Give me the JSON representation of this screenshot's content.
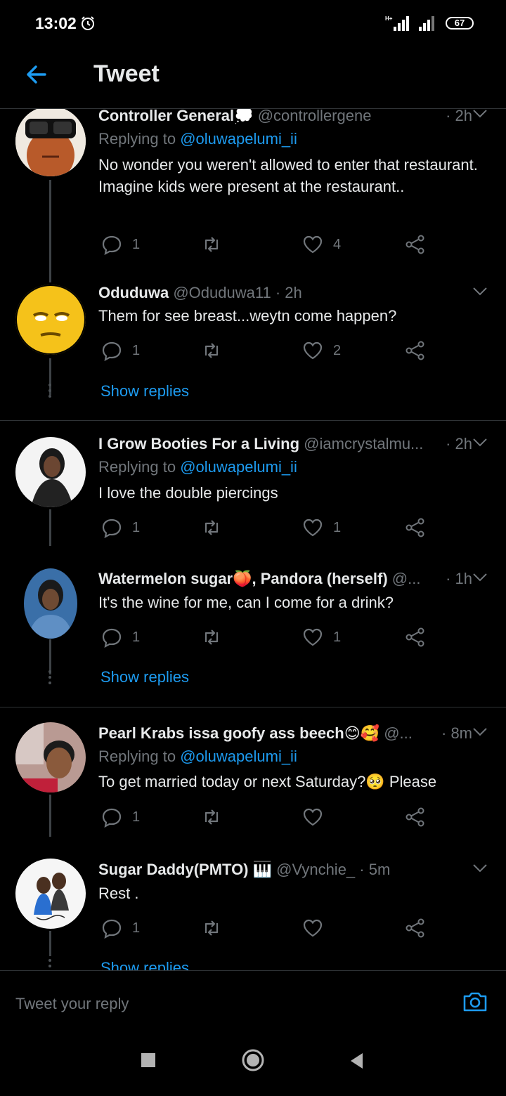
{
  "status_bar": {
    "time": "13:02",
    "network": "H+",
    "battery": "67"
  },
  "header": {
    "title": "Tweet",
    "back_icon": "back-arrow-icon"
  },
  "tweets": [
    {
      "name": "Controller General💭",
      "handle": "@controllergene",
      "time": "· 2h",
      "replying_prefix": "Replying to",
      "replying_to": "@oluwapelumi_ii",
      "text": "No wonder you weren't allowed to enter that restaurant. Imagine kids were present at the restaurant..",
      "replies": "1",
      "retweets": "",
      "likes": "4"
    },
    {
      "name": "Oduduwa",
      "handle": "@Oduduwa11",
      "time": "· 2h",
      "text": "Them for see breast...weytn come happen?",
      "replies": "1",
      "retweets": "",
      "likes": "2",
      "show_replies": "Show replies"
    },
    {
      "name": "I Grow Booties For a Living",
      "handle": "@iamcrystalmu...",
      "time": "· 2h",
      "replying_prefix": "Replying to",
      "replying_to": "@oluwapelumi_ii",
      "text": "I love the double piercings",
      "replies": "1",
      "retweets": "",
      "likes": "1"
    },
    {
      "name": "Watermelon sugar🍑, Pandora (herself)",
      "handle": "@...",
      "time": "· 1h",
      "text": "It's the wine for me, can I come for a drink?",
      "replies": "1",
      "retweets": "",
      "likes": "1",
      "show_replies": "Show replies"
    },
    {
      "name": "Pearl Krabs issa goofy ass beech😊🥰",
      "handle": "@...",
      "time": "· 8m",
      "replying_prefix": "Replying to",
      "replying_to": "@oluwapelumi_ii",
      "text": "To get married today or next Saturday?🥺 Please",
      "replies": "1",
      "retweets": "",
      "likes": ""
    },
    {
      "name": "Sugar Daddy(PMTO) 🎹",
      "handle": "@Vynchie_",
      "time": "· 5m",
      "text": "Rest .",
      "replies": "1",
      "retweets": "",
      "likes": "",
      "show_replies": "Show replies"
    }
  ],
  "reply_bar": {
    "placeholder": "Tweet your reply",
    "icon": "camera-icon"
  },
  "nav_bar": {
    "icons": [
      "recents-icon",
      "home-icon",
      "back-icon"
    ]
  },
  "colors": {
    "accent": "#1d9bf0",
    "muted": "#71767b",
    "background": "#000000",
    "divider": "#2f3336"
  }
}
